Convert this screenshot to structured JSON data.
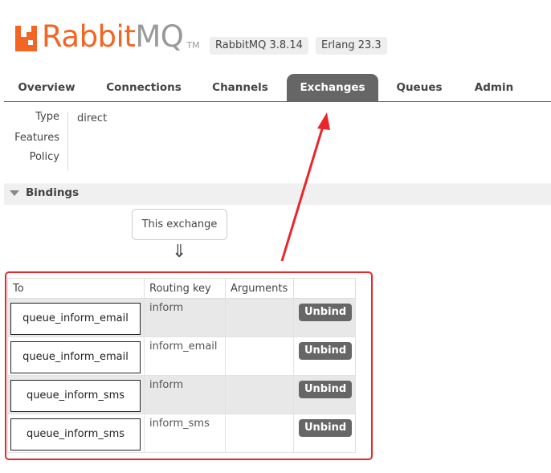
{
  "header": {
    "brand_rabbit": "Rabbit",
    "brand_mq": "MQ",
    "brand_tm": "TM",
    "version_rabbitmq": "RabbitMQ 3.8.14",
    "version_erlang": "Erlang 23.3"
  },
  "nav": {
    "tabs": [
      {
        "label": "Overview"
      },
      {
        "label": "Connections"
      },
      {
        "label": "Channels"
      },
      {
        "label": "Exchanges",
        "active": true
      },
      {
        "label": "Queues"
      },
      {
        "label": "Admin"
      }
    ]
  },
  "exchange": {
    "type_label": "Type",
    "type_value": "direct",
    "features_label": "Features",
    "policy_label": "Policy"
  },
  "bindings": {
    "section_title": "Bindings",
    "this_exchange": "This exchange",
    "arrow": "⇓",
    "columns": {
      "to": "To",
      "routing_key": "Routing key",
      "arguments": "Arguments"
    },
    "rows": [
      {
        "queue": "queue_inform_email",
        "routing_key": "inform",
        "arguments": "",
        "action": "Unbind"
      },
      {
        "queue": "queue_inform_email",
        "routing_key": "inform_email",
        "arguments": "",
        "action": "Unbind"
      },
      {
        "queue": "queue_inform_sms",
        "routing_key": "inform",
        "arguments": "",
        "action": "Unbind"
      },
      {
        "queue": "queue_inform_sms",
        "routing_key": "inform_sms",
        "arguments": "",
        "action": "Unbind"
      }
    ]
  },
  "colors": {
    "brand_orange": "#f26522",
    "nav_active_bg": "#666666",
    "annotation_red": "#e8262b"
  },
  "icons": [
    "rabbitmq-logo-icon",
    "collapse-triangle-icon",
    "double-down-arrow-icon"
  ]
}
